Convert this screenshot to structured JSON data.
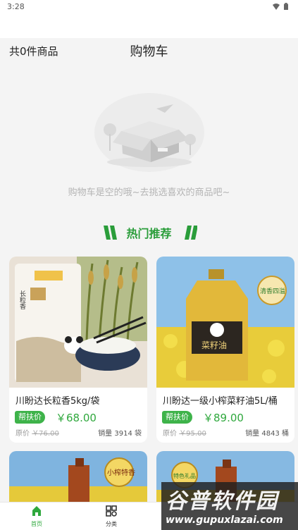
{
  "status_bar": {
    "time": "3:28",
    "icons": [
      "wifi-icon",
      "battery-icon"
    ]
  },
  "cart": {
    "count_label": "共0件商品",
    "title": "购物车"
  },
  "empty_state": {
    "icon": "empty-box-icon",
    "message": "购物车是空的哦~去挑选喜欢的商品吧~"
  },
  "hot": {
    "label": "热门推荐",
    "accent_color": "#2a9d3a"
  },
  "rice_package": {
    "side_label": "长粒香"
  },
  "oil_bottle": {
    "label": "菜籽油"
  },
  "badges": {
    "qingxiang": "清香四溢",
    "xiaozha": "小榨特香",
    "gift": "特色礼品"
  },
  "products": [
    {
      "name": "川盼达长粒香5kg/袋",
      "tag": "帮扶价",
      "price": "￥68.00",
      "orig_label": "原价",
      "orig_price": "￥76.00",
      "sales": "销量 3914 袋"
    },
    {
      "name": "川盼达一级小榨菜籽油5L/桶",
      "tag": "帮扶价",
      "price": "￥89.00",
      "orig_label": "原价",
      "orig_price": "￥95.00",
      "sales": "销量 4843 桶"
    }
  ],
  "tabbar": {
    "items": [
      {
        "label": "首页",
        "icon": "home-icon",
        "active": true
      },
      {
        "label": "分类",
        "icon": "grid-icon",
        "active": false
      }
    ]
  },
  "watermark": {
    "line1": "谷普软件园",
    "line2": "www.gupuxlazai.com"
  }
}
